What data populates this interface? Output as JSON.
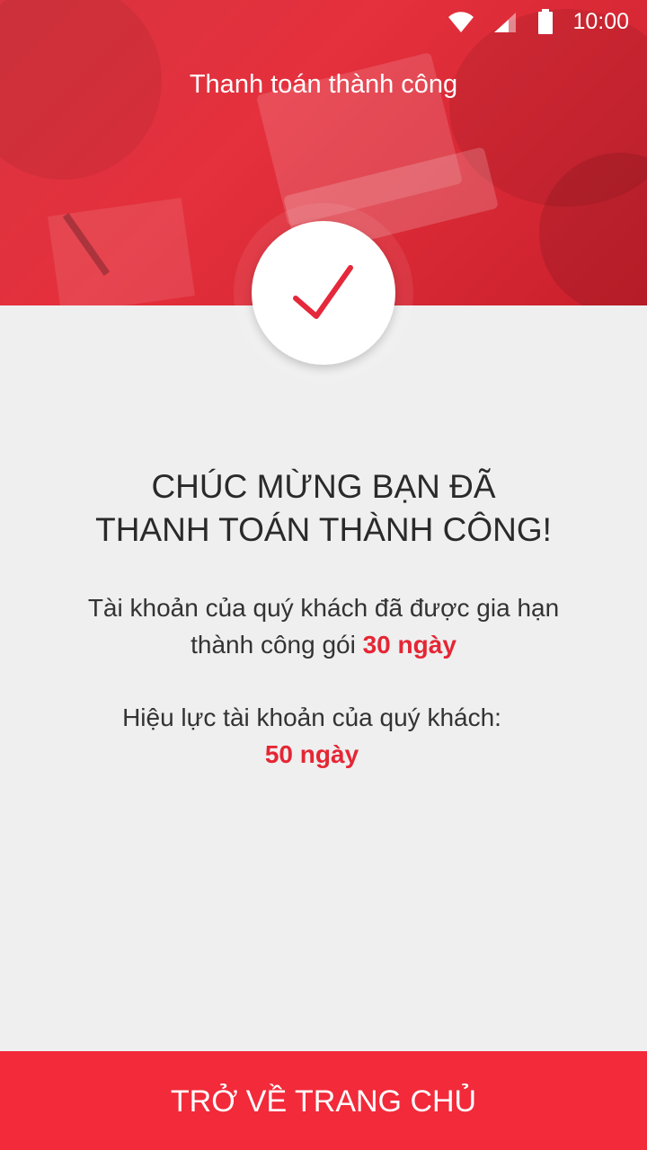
{
  "status_bar": {
    "time": "10:00",
    "icons": [
      "wifi-icon",
      "signal-icon",
      "battery-icon"
    ]
  },
  "header": {
    "title": "Thanh toán thành công"
  },
  "success": {
    "icon": "checkmark-icon",
    "headline_line1": "CHÚC MỪNG BẠN ĐÃ",
    "headline_line2": "THANH TOÁN THÀNH CÔNG!"
  },
  "renewal": {
    "line1": "Tài khoản của quý khách đã được gia hạn",
    "line2_prefix": "thành công gói",
    "package": "30 ngày"
  },
  "validity": {
    "label": "Hiệu lực tài khoản của quý khách:",
    "value": "50 ngày"
  },
  "footer": {
    "button_label": "TRỞ VỀ TRANG CHỦ"
  },
  "colors": {
    "primary": "#f22a3a",
    "highlight": "#e52634",
    "background": "#efefef"
  }
}
